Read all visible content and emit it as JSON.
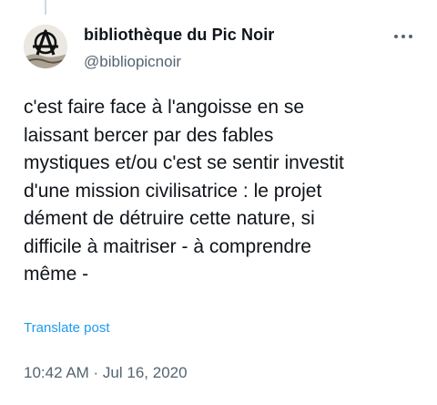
{
  "account": {
    "display_name": "bibliothèque du Pic Noir",
    "handle": "@bibliopicnoir",
    "avatar_icon": "anarchy-a-logo-avatar"
  },
  "tweet": {
    "text": "c'est faire face à l'angoisse en se\nlaissant bercer par des fables\nmystiques et/ou c'est se sentir investit\nd'une mission civilisatrice : le projet\ndément de détruire cette nature, si\ndifficile à maitriser - à comprendre\nmême -",
    "translate_label": "Translate post",
    "timestamp": "10:42 AM · Jul 16, 2020"
  },
  "icons": {
    "more": "more-options-icon"
  },
  "colors": {
    "text_primary": "#0f1419",
    "text_secondary": "#536471",
    "link": "#1d9bf0",
    "thread_line": "#cfd9de"
  }
}
